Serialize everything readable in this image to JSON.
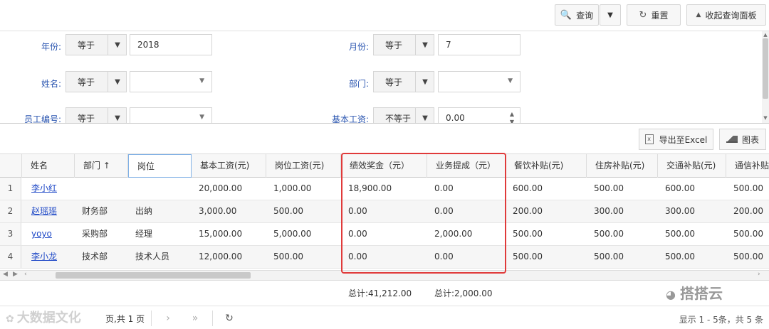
{
  "toolbar": {
    "query_label": "查询",
    "reset_label": "重置",
    "collapse_label": "收起查询面板"
  },
  "filters": {
    "year": {
      "label": "年份:",
      "op": "等于",
      "value": "2018"
    },
    "month": {
      "label": "月份:",
      "op": "等于",
      "value": "7"
    },
    "name": {
      "label": "姓名:",
      "op": "等于",
      "value": ""
    },
    "dept": {
      "label": "部门:",
      "op": "等于",
      "value": ""
    },
    "empno": {
      "label": "员工编号:",
      "op": "等于",
      "value": ""
    },
    "salary": {
      "label": "基本工资:",
      "op": "不等于",
      "value": "0.00"
    }
  },
  "grid_tools": {
    "export_label": "导出至Excel",
    "chart_label": "图表"
  },
  "columns": [
    "姓名",
    "部门 ↑",
    "岗位",
    "基本工资(元)",
    "岗位工资(元)",
    "绩效奖金（元）",
    "业务提成（元）",
    "餐饮补贴(元)",
    "住房补贴(元)",
    "交通补贴(元)",
    "通信补贴"
  ],
  "rows": [
    {
      "num": "1",
      "name": "李小红",
      "dept": "",
      "post": "",
      "base": "20,000.00",
      "postpay": "1,000.00",
      "bonus": "18,900.00",
      "comm": "0.00",
      "meal": "600.00",
      "house": "500.00",
      "traffic": "600.00",
      "phone": "500.00"
    },
    {
      "num": "2",
      "name": "赵瑶瑶",
      "dept": "财务部",
      "post": "出纳",
      "base": "3,000.00",
      "postpay": "500.00",
      "bonus": "0.00",
      "comm": "0.00",
      "meal": "200.00",
      "house": "300.00",
      "traffic": "300.00",
      "phone": "200.00"
    },
    {
      "num": "3",
      "name": "yoyo",
      "dept": "采购部",
      "post": "经理",
      "base": "15,000.00",
      "postpay": "5,000.00",
      "bonus": "0.00",
      "comm": "2,000.00",
      "meal": "500.00",
      "house": "500.00",
      "traffic": "500.00",
      "phone": "500.00"
    },
    {
      "num": "4",
      "name": "李小龙",
      "dept": "技术部",
      "post": "技术人员",
      "base": "12,000.00",
      "postpay": "500.00",
      "bonus": "0.00",
      "comm": "0.00",
      "meal": "500.00",
      "house": "500.00",
      "traffic": "500.00",
      "phone": "500.00"
    }
  ],
  "totals": {
    "bonus": "总计:41,212.00",
    "comm": "总计:2,000.00"
  },
  "pager": {
    "page_text": "页,共 1 页",
    "summary": "显示 1 - 5条，共 5 条"
  },
  "watermarks": {
    "left": "大数据文化",
    "right": "搭搭云"
  }
}
